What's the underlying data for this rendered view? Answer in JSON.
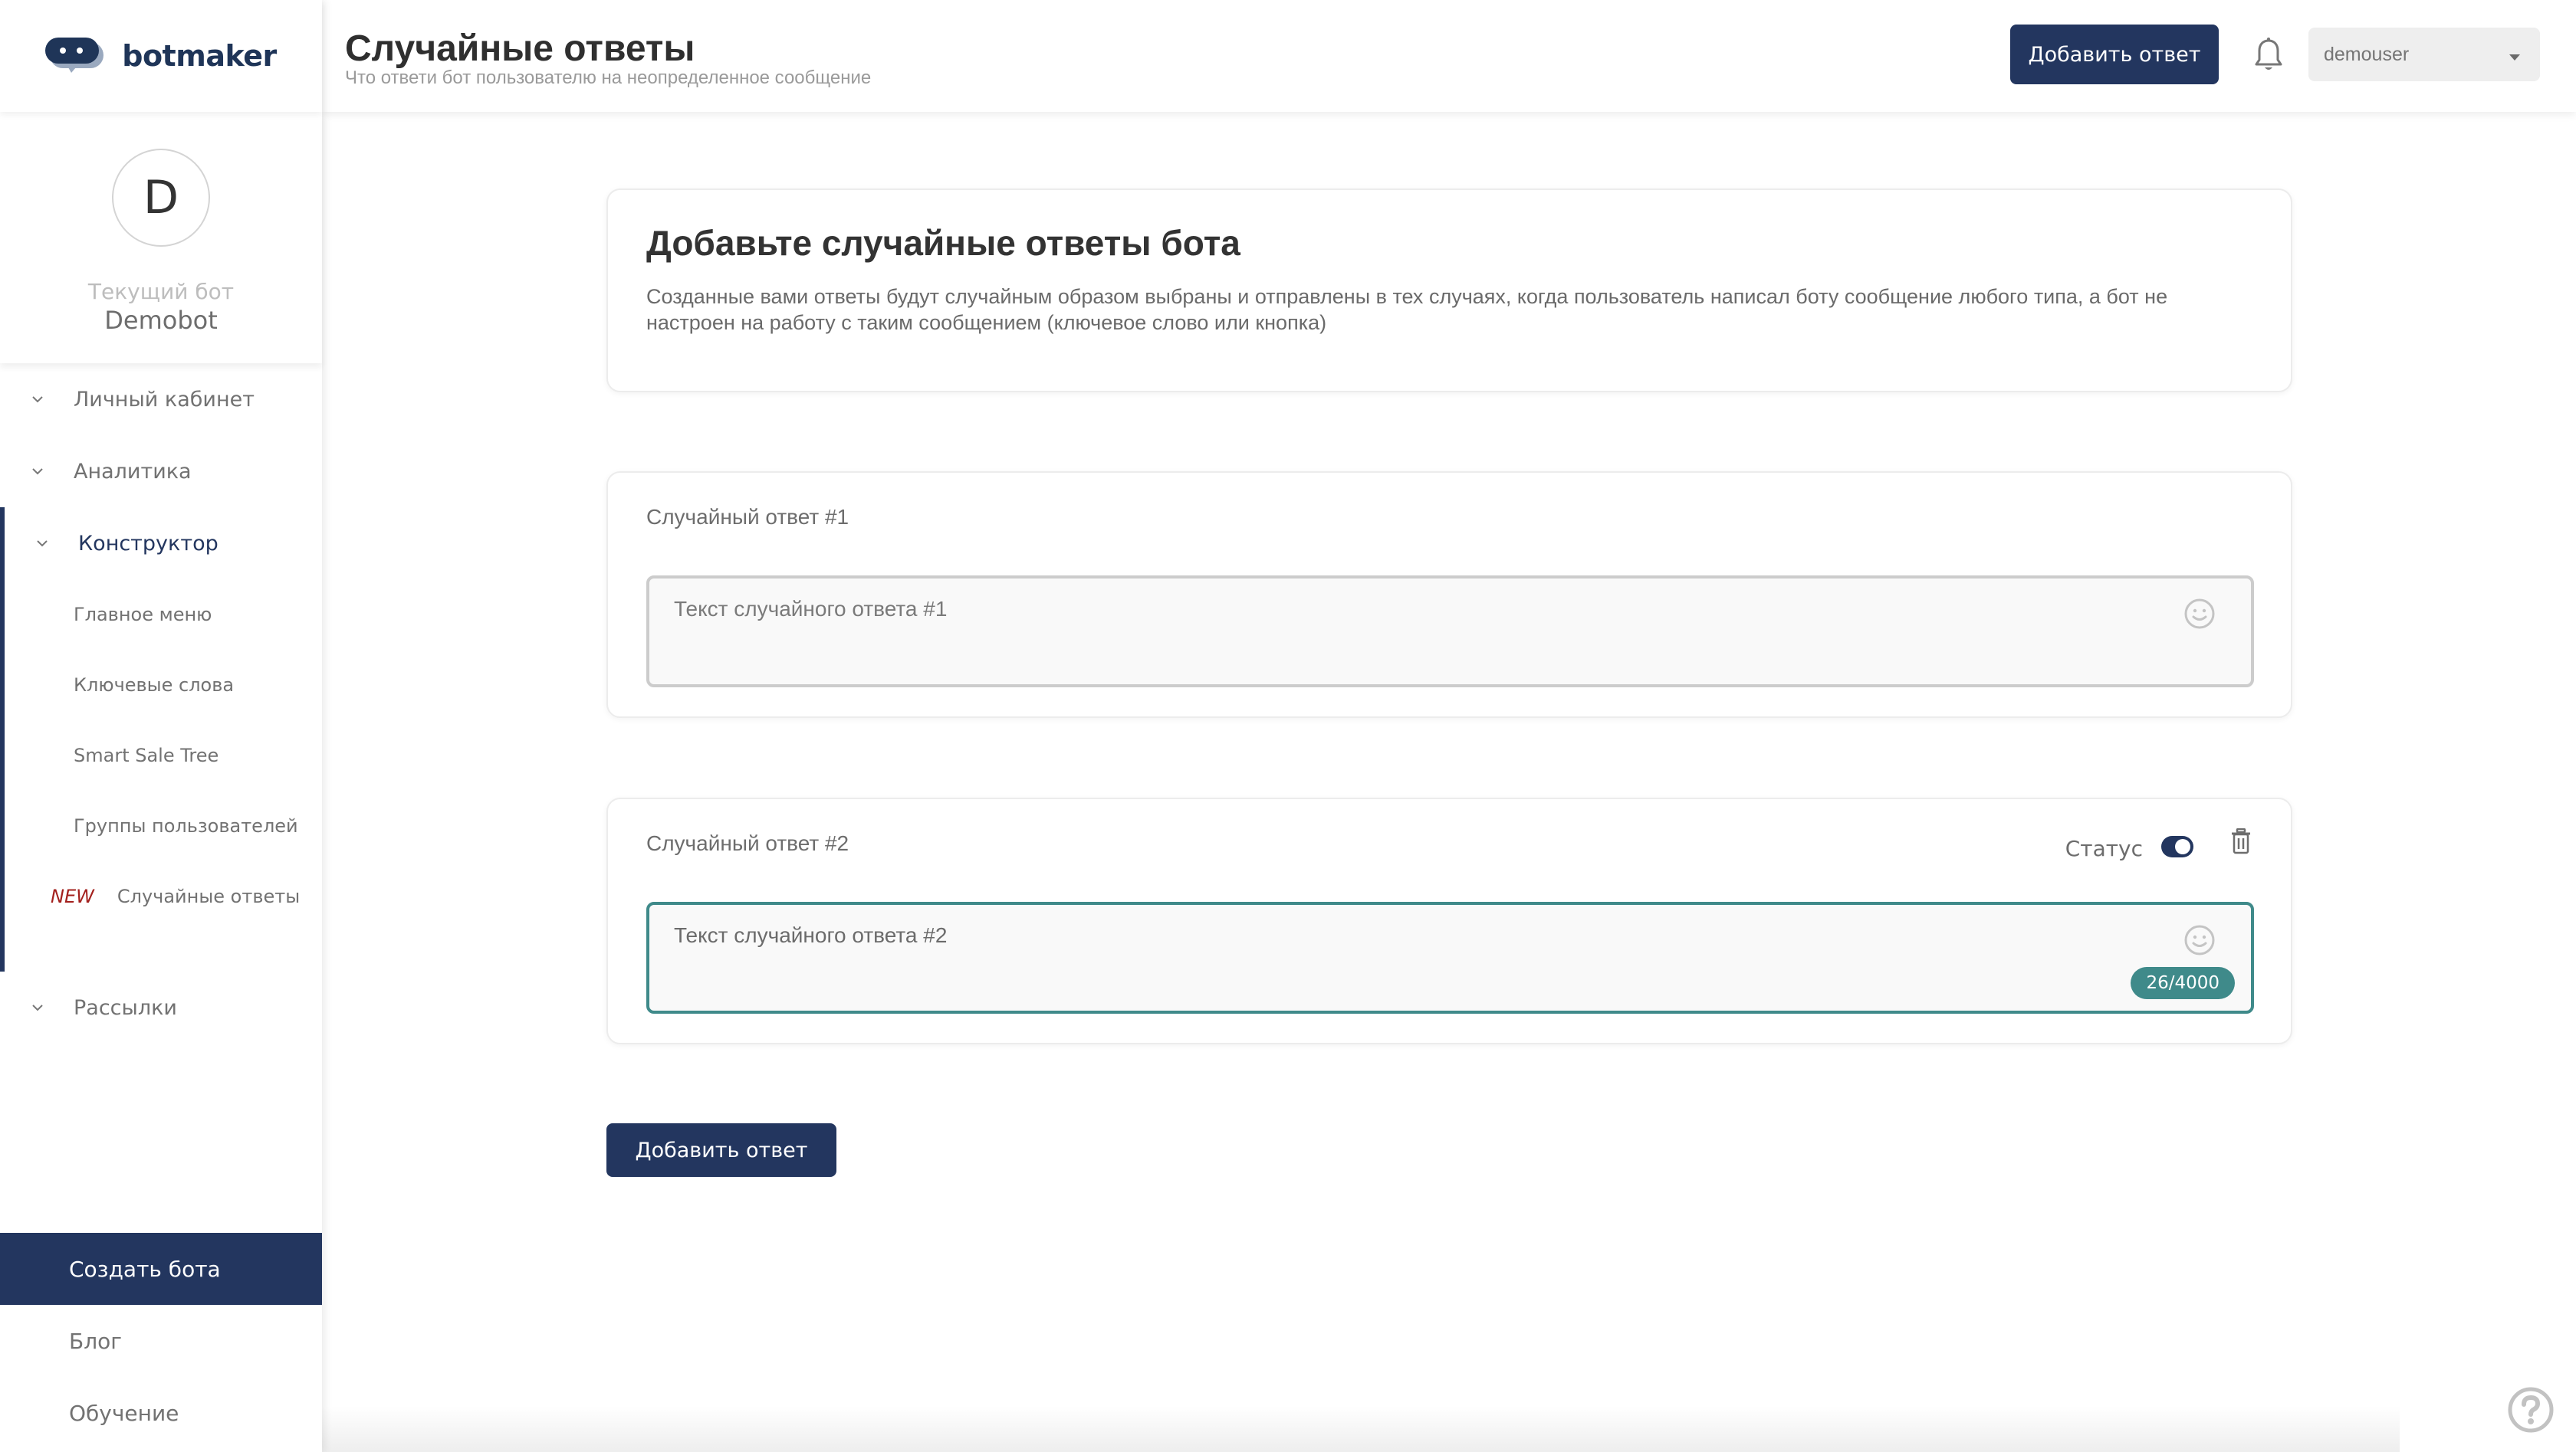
{
  "brand": {
    "name": "botmaker",
    "color": "#1f3558"
  },
  "bot": {
    "avatar_letter": "D",
    "caption": "Текущий бот",
    "name": "Demobot"
  },
  "sidebar": {
    "items": [
      {
        "label": "Личный кабинет",
        "icon": "chevron-down-icon"
      },
      {
        "label": "Аналитика",
        "icon": "chevron-down-icon"
      }
    ],
    "group": {
      "label": "Конструктор",
      "icon": "chevron-down-icon",
      "children": [
        {
          "label": "Главное меню"
        },
        {
          "label": "Ключевые слова"
        },
        {
          "label": "Smart Sale Tree"
        },
        {
          "label": "Группы пользователей"
        },
        {
          "label": "Случайные ответы",
          "badge": "NEW"
        }
      ]
    },
    "after_group": [
      {
        "label": "Рассылки",
        "icon": "chevron-down-icon"
      }
    ],
    "bottom": [
      {
        "label": "Создать бота",
        "active": true
      },
      {
        "label": "Блог"
      },
      {
        "label": "Обучение"
      }
    ]
  },
  "header": {
    "title": "Случайные ответы",
    "subtitle": "Что ответи бот пользователю на неопределенное сообщение",
    "add_button": "Добавить ответ",
    "bell_icon": "bell-icon",
    "user_select": "demouser"
  },
  "intro": {
    "title": "Добавьте случайные ответы бота",
    "text": "Созданные вами ответы будут случайным образом выбраны и отправлены в тех случаях, когда пользователь написал боту сообщение любого типа, а бот не настроен на работу с таким сообщением (ключевое слово или кнопка)"
  },
  "answers": [
    {
      "label": "Случайный ответ #1",
      "placeholder": "Текст случайного ответа #1",
      "value": ""
    },
    {
      "label": "Случайный ответ #2",
      "placeholder": "",
      "value": "Текст случайного ответа #2",
      "status_label": "Статус",
      "status_on": true,
      "counter": "26/4000"
    }
  ],
  "bottom_add_button": "Добавить ответ",
  "colors": {
    "primary": "#23365f",
    "accent_teal": "#3f8a8a",
    "new_badge": "#a3201d"
  }
}
